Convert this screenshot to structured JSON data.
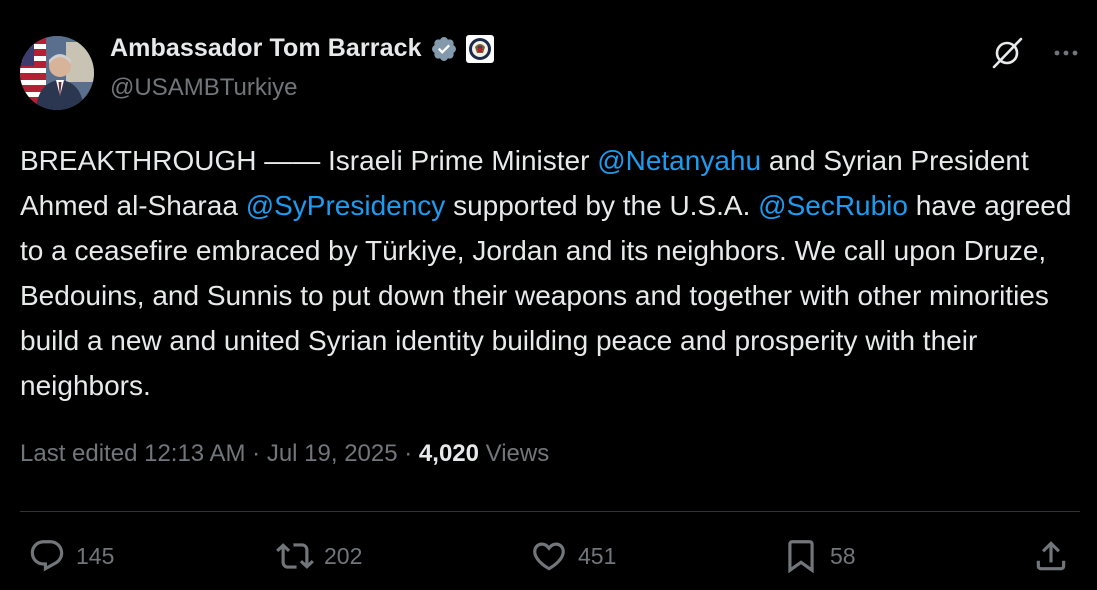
{
  "author": {
    "display_name": "Ambassador Tom Barrack",
    "handle": "@USAMBTurkiye",
    "verified": true,
    "affiliation_badge": "us-department-of-state-seal"
  },
  "tweet": {
    "segments": [
      {
        "type": "text",
        "text": "BREAKTHROUGH —— Israeli Prime Minister "
      },
      {
        "type": "mention",
        "text": "@Netanyahu"
      },
      {
        "type": "text",
        "text": " and Syrian President Ahmed al-Sharaa "
      },
      {
        "type": "mention",
        "text": "@SyPresidency"
      },
      {
        "type": "text",
        "text": " supported by the U.S.A. "
      },
      {
        "type": "mention",
        "text": "@SecRubio"
      },
      {
        "type": "text",
        "text": " have agreed to a ceasefire embraced by Türkiye, Jordan and its neighbors. We call upon Druze, Bedouins, and Sunnis to put down their weapons and together with other minorities build a new and united Syrian identity building peace and prosperity with their neighbors."
      }
    ],
    "meta": {
      "edited_prefix": "Last edited 12:13 AM · Jul 19, 2025 · ",
      "views_count": "4,020",
      "views_label": " Views"
    }
  },
  "engagement": {
    "replies": "145",
    "reposts": "202",
    "likes": "451",
    "bookmarks": "58"
  },
  "icons": {
    "reply": "reply-icon",
    "repost": "repost-icon",
    "like": "like-icon",
    "bookmark": "bookmark-icon",
    "share": "share-icon",
    "grok": "grok-icon",
    "more": "more-icon"
  },
  "colors": {
    "background": "#000000",
    "text": "#e7e9ea",
    "secondary": "#71767b",
    "link": "#1d9bf0",
    "verified": "#829aab",
    "divider": "#2f3336"
  }
}
